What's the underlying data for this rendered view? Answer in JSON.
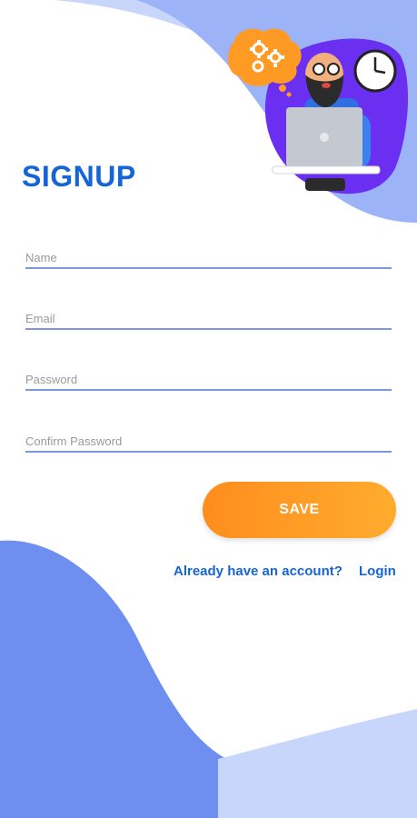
{
  "form": {
    "title": "SIGNUP",
    "fields": {
      "name": {
        "placeholder": "Name",
        "value": ""
      },
      "email": {
        "placeholder": "Email",
        "value": ""
      },
      "password": {
        "placeholder": "Password",
        "value": ""
      },
      "confirm_password": {
        "placeholder": "Confirm Password",
        "value": ""
      }
    },
    "save_label": "SAVE"
  },
  "footer": {
    "prompt": "Already have an account?",
    "login_label": "Login"
  },
  "colors": {
    "accent": "#1565d8",
    "button": "#ff9a24",
    "wave_light": "#c9d6fb",
    "wave_mid": "#9db3f7",
    "wave_dark": "#6e8ff0",
    "illustration_blob": "#6a2ff0"
  },
  "icons": [
    "gears-icon",
    "clock-icon",
    "laptop-icon",
    "thought-bubble-icon"
  ]
}
